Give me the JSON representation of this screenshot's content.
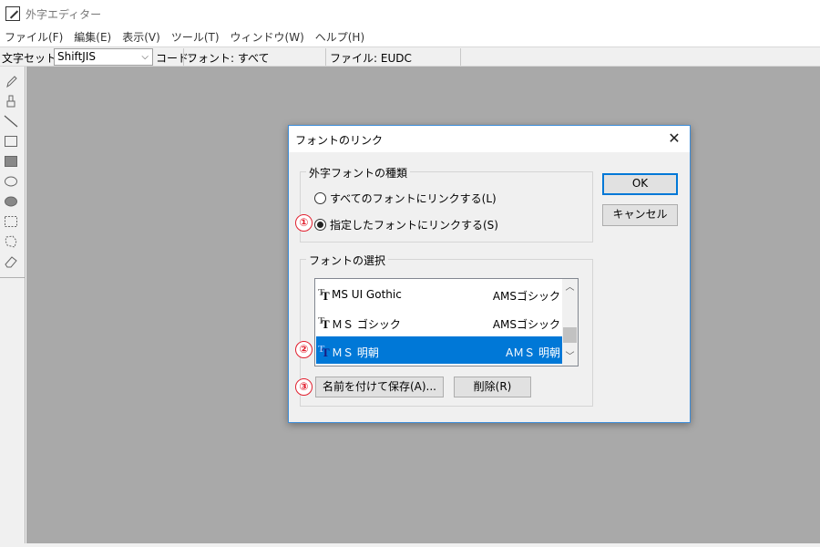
{
  "window": {
    "title": "外字エディター"
  },
  "menu": [
    "ファイル(F)",
    "編集(E)",
    "表示(V)",
    "ツール(T)",
    "ウィンドウ(W)",
    "ヘルプ(H)"
  ],
  "toolbar": {
    "charset_label": "文字セット:",
    "charset_value": "ShiftJIS",
    "code_label": "コード:",
    "font_label": "フォント: すべて",
    "file_label": "ファイル: EUDC"
  },
  "tools": [
    "pencil-icon",
    "brush-icon",
    "line-icon",
    "hollow-rectangle-icon",
    "filled-rectangle-icon",
    "hollow-ellipse-icon",
    "filled-ellipse-icon",
    "rectangular-select-icon",
    "freeform-select-icon",
    "eraser-icon"
  ],
  "dialog": {
    "title": "フォントのリンク",
    "type_group_label": "外字フォントの種類",
    "radio_all": "すべてのフォントにリンクする(L)",
    "radio_specific": "指定したフォントにリンクする(S)",
    "radio_selected": "specific",
    "font_group_label": "フォントの選択",
    "fonts": [
      {
        "name": "MS UI Gothic",
        "alias": "AMSゴシック"
      },
      {
        "name": "ＭＳ ゴシック",
        "alias": "AMSゴシック"
      },
      {
        "name": "ＭＳ 明朝",
        "alias": "AＭＳ 明朝"
      }
    ],
    "selected_font_index": 2,
    "ok_label": "OK",
    "cancel_label": "キャンセル",
    "save_as_label": "名前を付けて保存(A)...",
    "delete_label": "削除(R)"
  },
  "callouts": [
    "①",
    "②",
    "③"
  ],
  "colors": {
    "accent": "#0078d7",
    "callout": "#e2202f",
    "canvas": "#a9a9a9"
  }
}
